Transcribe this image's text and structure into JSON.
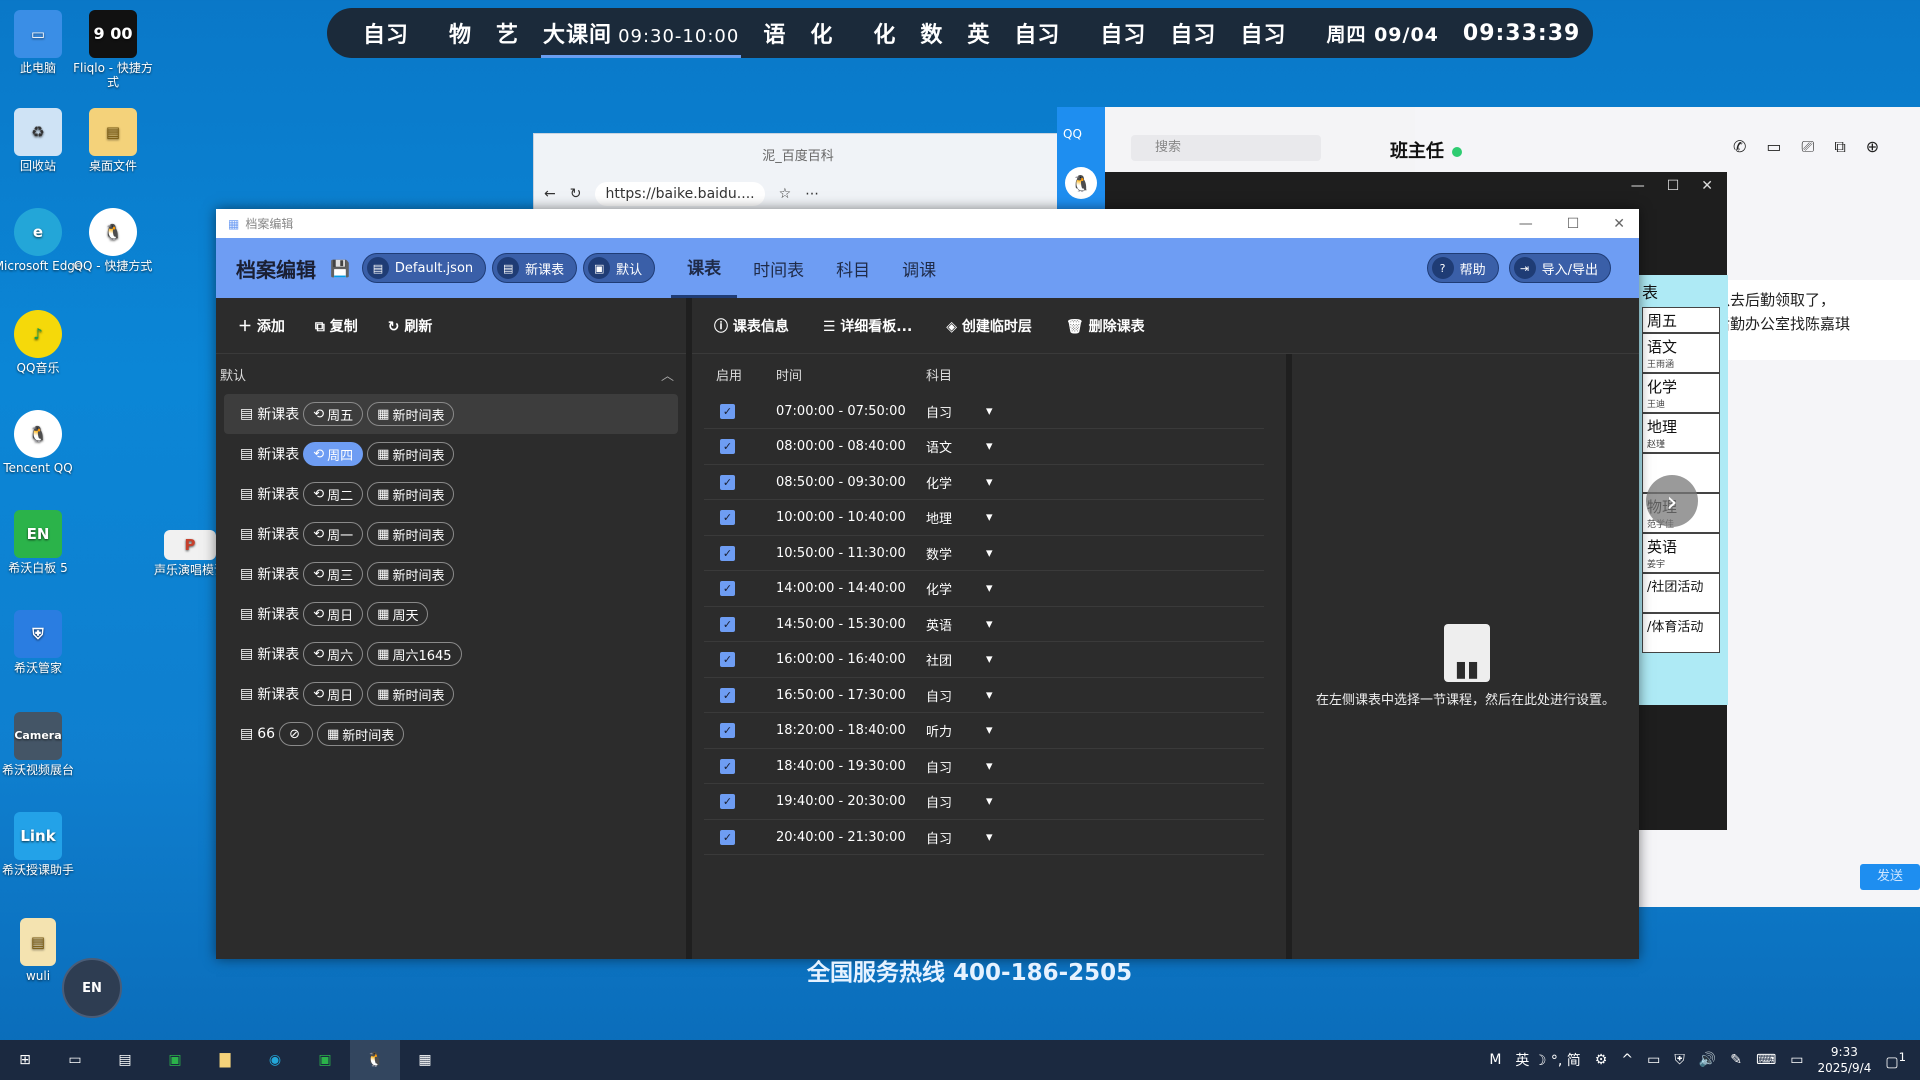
{
  "desktop_icons": [
    {
      "label": "此电脑",
      "icon": "computer-icon"
    },
    {
      "label": "Fliqlo - 快捷方式",
      "icon": "clock-icon",
      "art": "9 00"
    },
    {
      "label": "回收站",
      "icon": "recycle-bin-icon"
    },
    {
      "label": "桌面文件",
      "icon": "folder-icon"
    },
    {
      "label": "Microsoft Edge",
      "icon": "edge-icon"
    },
    {
      "label": "QQ - 快捷方式",
      "icon": "qq-icon"
    },
    {
      "label": "QQ音乐",
      "icon": "qq-music-icon"
    },
    {
      "label": "Tencent QQ",
      "icon": "qq-icon"
    },
    {
      "label": "希沃白板 5",
      "icon": "easinote-icon",
      "art": "EN"
    },
    {
      "label": "声乐演唱模课",
      "icon": "ppt-file-icon"
    },
    {
      "label": "希沃管家",
      "icon": "shield-icon"
    },
    {
      "label": "希沃视频展台",
      "icon": "camera-icon",
      "art": "Camera"
    },
    {
      "label": "希沃授课助手",
      "icon": "link-icon",
      "art": "Link"
    },
    {
      "label": "wuli",
      "icon": "folder-icon"
    }
  ],
  "topbar": {
    "items": [
      "自习",
      "物",
      "艺",
      "大课间",
      "语",
      "化",
      "化",
      "数",
      "英",
      "自习",
      "自习",
      "自习",
      "自习"
    ],
    "current_time_range": "09:30-10:00",
    "date": "周四 09/04",
    "time": "09:33:39"
  },
  "browser": {
    "tab_title": "泥_百度百科",
    "url": "https://baike.baidu...."
  },
  "qq": {
    "app_label": "QQ",
    "search_placeholder": "搜索",
    "chat_name": "班主任",
    "message_line1": "以去后勤领取了，",
    "message_line2": "后勤办公室找陈嘉琪",
    "send_label": "发送"
  },
  "timetable_popup": {
    "header": "表",
    "items": [
      {
        "subject": "周五",
        "teacher": ""
      },
      {
        "subject": "语文",
        "teacher": "王雨涵"
      },
      {
        "subject": "化学",
        "teacher": "王迪"
      },
      {
        "subject": "地理",
        "teacher": "赵瑾"
      },
      {
        "subject": "",
        "teacher": ""
      },
      {
        "subject": "物理",
        "teacher": "范学佳"
      },
      {
        "subject": "英语",
        "teacher": "姜宇"
      },
      {
        "subject": "/社团活动",
        "teacher": ""
      },
      {
        "subject": "/体育活动",
        "teacher": ""
      }
    ]
  },
  "editor": {
    "window_title": "档案编辑",
    "app_title": "档案编辑",
    "file_pill": "Default.json",
    "schedule_pill": "新课表",
    "default_pill": "默认",
    "tabs": [
      "课表",
      "时间表",
      "科目",
      "调课"
    ],
    "help_label": "帮助",
    "import_export_label": "导入/导出",
    "left_tools": [
      "添加",
      "复制",
      "刷新"
    ],
    "group_name": "默认",
    "profiles": [
      {
        "name": "新课表",
        "day": "周五",
        "timetable": "新时间表",
        "selected": true,
        "day_on": false
      },
      {
        "name": "新课表",
        "day": "周四",
        "timetable": "新时间表",
        "selected": false,
        "day_on": true
      },
      {
        "name": "新课表",
        "day": "周二",
        "timetable": "新时间表",
        "selected": false,
        "day_on": false
      },
      {
        "name": "新课表",
        "day": "周一",
        "timetable": "新时间表",
        "selected": false,
        "day_on": false
      },
      {
        "name": "新课表",
        "day": "周三",
        "timetable": "新时间表",
        "selected": false,
        "day_on": false
      },
      {
        "name": "新课表",
        "day": "周日",
        "timetable": "周天",
        "selected": false,
        "day_on": false
      },
      {
        "name": "新课表",
        "day": "周六",
        "timetable": "周六1645",
        "selected": false,
        "day_on": false
      },
      {
        "name": "新课表",
        "day": "周日",
        "timetable": "新时间表",
        "selected": false,
        "day_on": false
      },
      {
        "name": "66",
        "day": "",
        "timetable": "新时间表",
        "selected": false,
        "day_on": false
      }
    ],
    "mid_tools": [
      "课表信息",
      "详细看板...",
      "创建临时层",
      "删除课表"
    ],
    "columns": [
      "启用",
      "时间",
      "科目"
    ],
    "lessons": [
      {
        "time": "07:00:00 - 07:50:00",
        "subject": "自习"
      },
      {
        "time": "08:00:00 - 08:40:00",
        "subject": "语文"
      },
      {
        "time": "08:50:00 - 09:30:00",
        "subject": "化学"
      },
      {
        "time": "10:00:00 - 10:40:00",
        "subject": "地理"
      },
      {
        "time": "10:50:00 - 11:30:00",
        "subject": "数学"
      },
      {
        "time": "14:00:00 - 14:40:00",
        "subject": "化学"
      },
      {
        "time": "14:50:00 - 15:30:00",
        "subject": "英语"
      },
      {
        "time": "16:00:00 - 16:40:00",
        "subject": "社团"
      },
      {
        "time": "16:50:00 - 17:30:00",
        "subject": "自习"
      },
      {
        "time": "18:20:00 - 18:40:00",
        "subject": "听力"
      },
      {
        "time": "18:40:00 - 19:30:00",
        "subject": "自习"
      },
      {
        "time": "19:40:00 - 20:30:00",
        "subject": "自习"
      },
      {
        "time": "20:40:00 - 21:30:00",
        "subject": "自习"
      }
    ],
    "hint": "在左侧课表中选择一节课程，然后在此处进行设置。"
  },
  "hotline": "全国服务热线 400-186-2505",
  "taskbar": {
    "tray_text": "英 ☽ °, 简",
    "clock_time": "9:33",
    "clock_date": "2025/9/4",
    "notification_count": "1"
  },
  "colors": {
    "accent": "#6e9df3",
    "topbar_bg": "#1b2a3a",
    "editor_bg": "#2c2c2c",
    "taskbar_bg": "#1b2940"
  }
}
